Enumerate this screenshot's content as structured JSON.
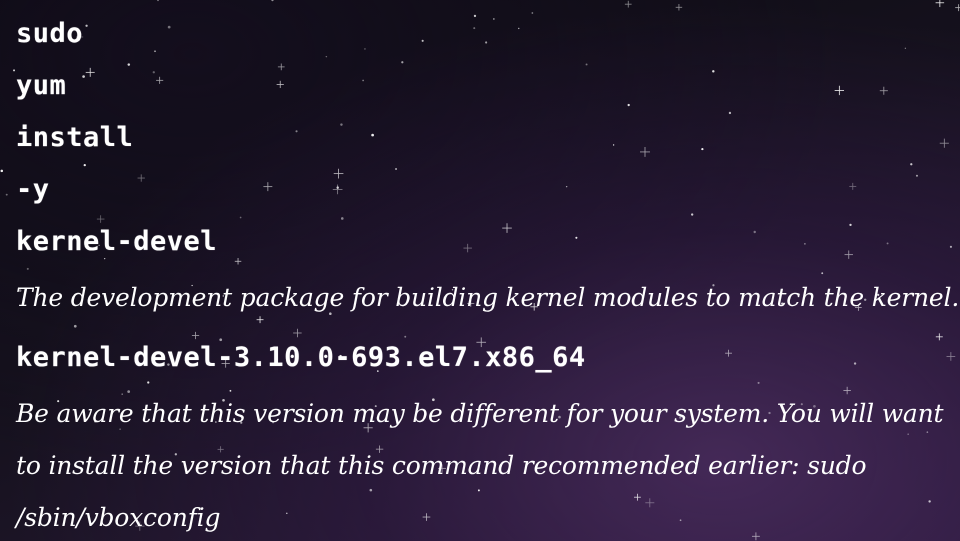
{
  "commands": [
    "sudo",
    "yum",
    "install",
    "-y",
    "kernel-devel"
  ],
  "description": "The development package for building kernel modules to match the kernel.",
  "package_version": "kernel-devel-3.10.0-693.el7.x86_64",
  "warning": "Be aware that this version may be different for your system. You will want to install the version that this command recommended earlier: sudo /sbin/vboxconfig",
  "colors": {
    "text": "#ffffff",
    "background_dark": "#0b0a10",
    "background_accent": "#2a1b38"
  }
}
